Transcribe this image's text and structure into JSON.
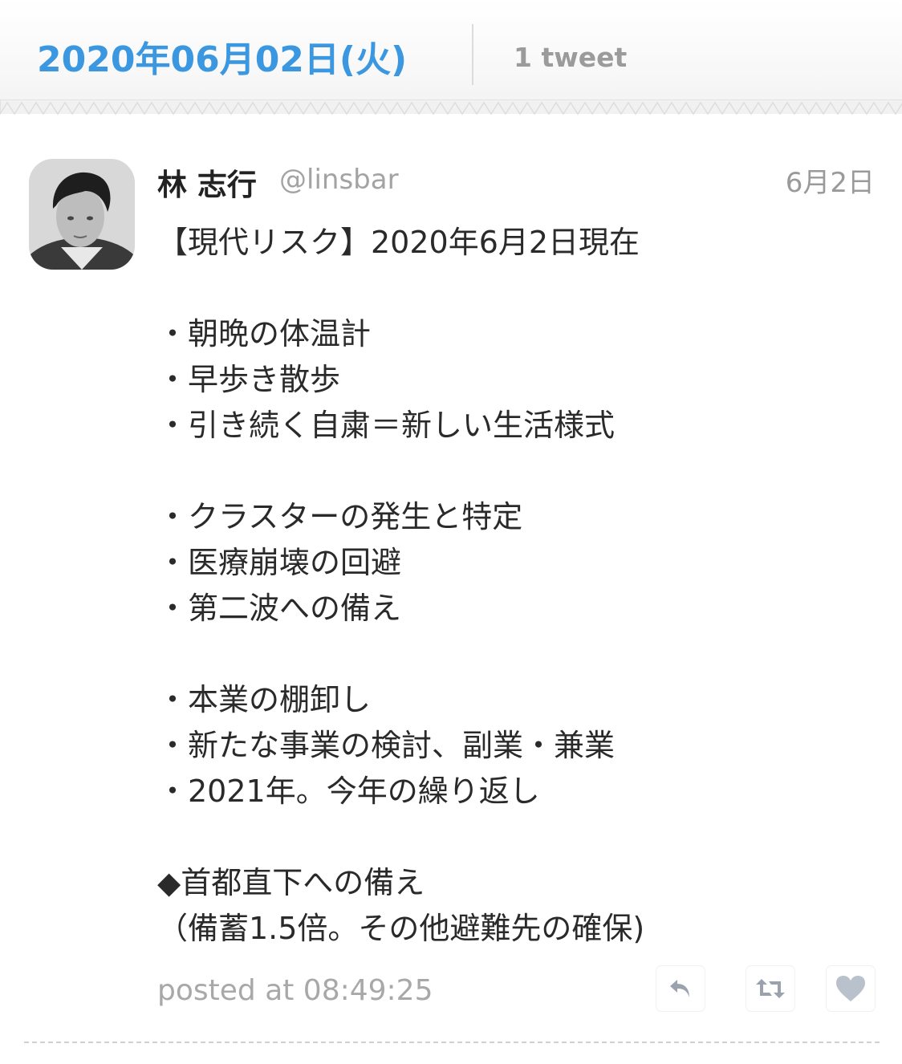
{
  "header": {
    "date": "2020年06月02日(火)",
    "tweet_count": "1 tweet"
  },
  "tweet": {
    "author_name": "林 志行",
    "author_handle": "@linsbar",
    "date": "6月2日",
    "lines": [
      "【現代リスク】2020年6月2日現在",
      "",
      "・朝晩の体温計",
      "・早歩き散歩",
      "・引き続く自粛＝新しい生活様式",
      "",
      "・クラスターの発生と特定",
      "・医療崩壊の回避",
      "・第二波への備え",
      "",
      "・本業の棚卸し",
      "・新たな事業の検討、副業・兼業",
      "・2021年。今年の繰り返し",
      "",
      "◆首都直下への備え",
      "（備蓄1.5倍。その他避難先の確保)"
    ],
    "posted_at": "posted at 08:49:25",
    "actions": {
      "reply_icon": "reply-icon",
      "retweet_icon": "retweet-icon",
      "like_icon": "heart-icon"
    }
  },
  "colors": {
    "date_accent": "#3a97e0",
    "muted_text": "#a3a3a3",
    "action_icon": "#9aa3ad",
    "like_icon": "#b9c2cc"
  }
}
